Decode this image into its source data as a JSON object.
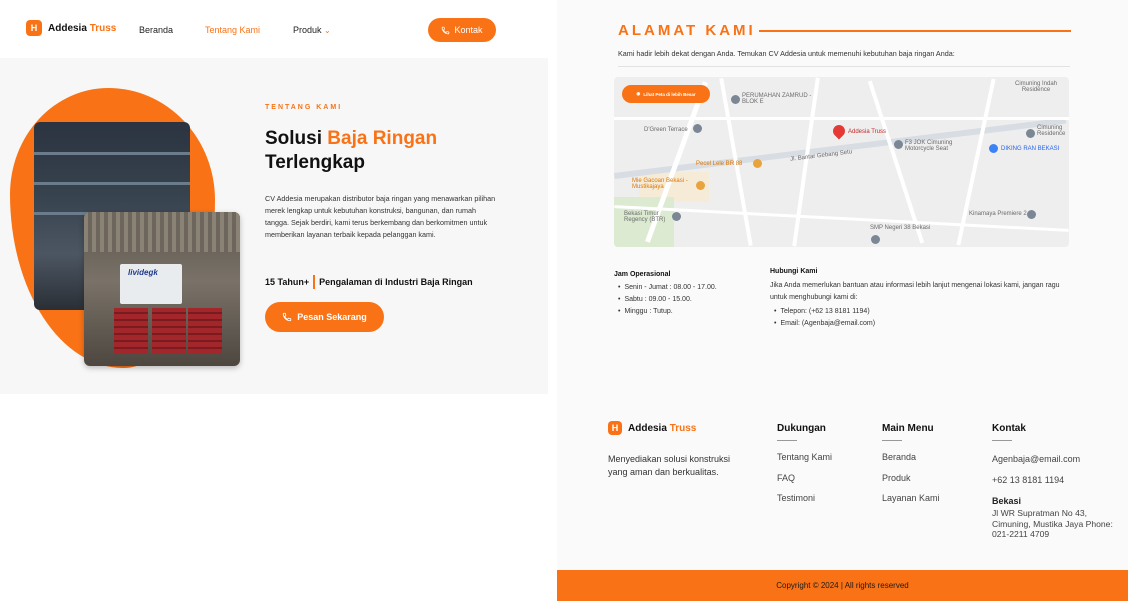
{
  "brand": {
    "name_prefix": "Addesia",
    "name_suffix": "Truss",
    "accent": "#f97316"
  },
  "nav": {
    "links": [
      "Beranda",
      "Tentang Kami",
      "Produk"
    ],
    "active": "Tentang Kami",
    "produk_chevron_icon": "chevron-down-icon",
    "kontak_label": "Kontak",
    "kontak_icon": "phone-icon"
  },
  "hero": {
    "eyebrow": "TENTANG KAMI",
    "title_plain": "Solusi ",
    "title_highlight": "Baja Ringan",
    "title_line2": "Terlengkap",
    "description": "CV Addesia merupakan distributor baja ringan yang menawarkan pilihan merek lengkap untuk kebutuhan konstruksi, bangunan, dan rumah tangga. Sejak berdiri, kami terus berkembang dan berkomitmen untuk memberikan layanan terbaik kepada pelanggan kami.",
    "stat_number": "15 Tahun+",
    "stat_text": "Pengalaman di Industri Baja Ringan",
    "cta_label": "Pesan Sekarang",
    "cta_icon": "phone-icon",
    "photo_sign": "lividegk"
  },
  "alamat": {
    "title": "ALAMAT KAMI",
    "subtitle": "Kami hadir lebih dekat dengan Anda. Temukan CV Addesia untuk memenuhi kebutuhan baja ringan Anda:",
    "map": {
      "button_label": "Lihat Peta di lebih Besar",
      "pin_label": "Addesia Truss",
      "labels": [
        "PERUMAHAN ZAMRUD - BLOK E",
        "D'Green Terrace",
        "Cimuning Indah Residence",
        "Cimuning Residence",
        "F3 JOK Cimuning Motorcycle Seat",
        "DIKING RAN BEKASI",
        "Pecel Lele BR 88",
        "Jl. Bantar Gebang Setu",
        "Mie Gacoan Bekasi - Mustikajaya",
        "Bekasi Timur Regency (BTR)",
        "Kinamaya Premiere 2",
        "SMP Negeri 38 Bekasi"
      ]
    },
    "hours": {
      "title": "Jam Operasional",
      "items": [
        "Senin - Jumat : 08.00 - 17.00.",
        "Sabtu : 09.00 - 15.00.",
        "Minggu : Tutup."
      ]
    },
    "contact": {
      "title": "Hubungi Kami",
      "text": "Jika Anda memerlukan bantuan atau informasi lebih lanjut mengenai lokasi kami, jangan ragu untuk menghubungi kami di:",
      "items": [
        "Telepon: (+62 13 8181 1194)",
        "Email: (Agenbaja@email.com)"
      ]
    }
  },
  "footer": {
    "description": "Menyediakan solusi konstruksi yang aman dan berkualitas.",
    "dukungan": {
      "title": "Dukungan",
      "links": [
        "Tentang Kami",
        "FAQ",
        "Testimoni"
      ]
    },
    "main_menu": {
      "title": "Main Menu",
      "links": [
        "Beranda",
        "Produk",
        "Layanan Kami"
      ]
    },
    "kontak": {
      "title": "Kontak",
      "email": "Agenbaja@email.com",
      "phone": "+62 13 8181 1194",
      "city": "Bekasi",
      "address": "Jl WR Supratman No 43, Cimuning, Mustika Jaya Phone: 021-2211 4709"
    },
    "copyright": "Copyright © 2024 | All rights reserved"
  }
}
